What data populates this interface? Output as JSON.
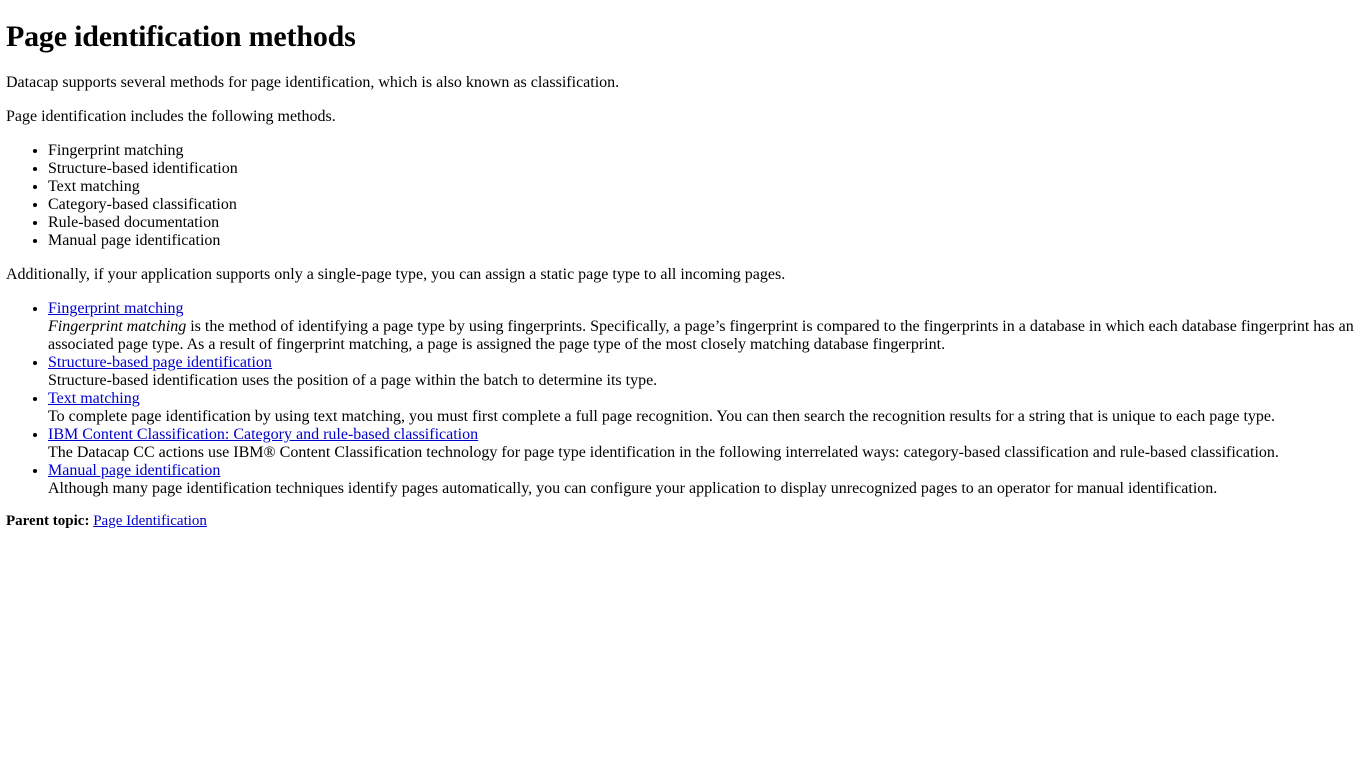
{
  "document": {
    "title": "Page identification methods",
    "intro_paragraphs": [
      "Datacap supports several methods for page identification, which is also known as classification.",
      "Page identification includes the following methods."
    ],
    "methods_list": [
      "Fingerprint matching",
      "Structure-based identification",
      "Text matching",
      "Category-based classification",
      "Rule-based documentation",
      "Manual page identification"
    ],
    "note_paragraph": "Additionally, if your application supports only a single-page type, you can assign a static page type to all incoming pages.",
    "topics": [
      {
        "link_label": "Fingerprint matching",
        "emphasis": "Fingerprint matching",
        "description": " is the method of identifying a page type by using fingerprints. Specifically, a page’s fingerprint is compared to the fingerprints in a database in which each database fingerprint has an associated page type. As a result of fingerprint matching, a page is assigned the page type of the most closely matching database fingerprint."
      },
      {
        "link_label": "Structure-based page identification",
        "emphasis": "",
        "description": "Structure-based identification uses the position of a page within the batch to determine its type."
      },
      {
        "link_label": "Text matching",
        "emphasis": "",
        "description": "To complete page identification by using text matching, you must first complete a full page recognition. You can then search the recognition results for a string that is unique to each page type."
      },
      {
        "link_label": "IBM Content Classification: Category and rule-based classification",
        "emphasis": "",
        "description": "The Datacap CC actions use IBM® Content Classification technology for page type identification in the following interrelated ways: category-based classification and rule-based classification."
      },
      {
        "link_label": "Manual page identification",
        "emphasis": "",
        "description": "Although many page identification techniques identify pages automatically, you can configure your application to display unrecognized pages to an operator for manual identification."
      }
    ],
    "parent_topic": {
      "label": "Parent topic:",
      "link_label": "Page Identification"
    },
    "colors": {
      "link": "#0000cc",
      "text": "#000000",
      "background": "#ffffff"
    }
  }
}
